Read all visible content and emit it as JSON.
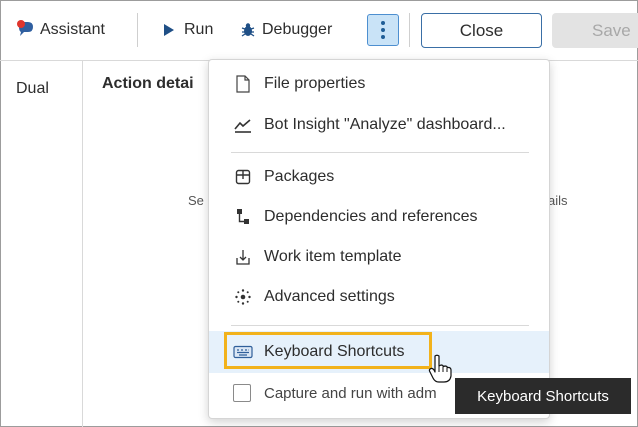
{
  "toolbar": {
    "assistant_label": "Assistant",
    "run_label": "Run",
    "debugger_label": "Debugger",
    "close_label": "Close",
    "save_label": "Save"
  },
  "left_panel": {
    "tab_label": "Dual"
  },
  "main": {
    "title": "Action detai",
    "select_fragment_left": "Se",
    "select_fragment_right": "ails"
  },
  "menu": {
    "items": [
      {
        "label": "File properties",
        "icon": "file-icon"
      },
      {
        "label": "Bot Insight \"Analyze\" dashboard...",
        "icon": "chart-line-icon"
      },
      {
        "label": "Packages",
        "icon": "package-icon"
      },
      {
        "label": "Dependencies and references",
        "icon": "dependencies-icon"
      },
      {
        "label": "Work item template",
        "icon": "work-item-icon"
      },
      {
        "label": "Advanced settings",
        "icon": "advanced-settings-icon"
      },
      {
        "label": "Keyboard Shortcuts",
        "icon": "keyboard-icon"
      },
      {
        "label": "Capture and run with adm",
        "icon": "checkbox"
      }
    ]
  },
  "tooltip": {
    "text": "Keyboard Shortcuts"
  },
  "colors": {
    "highlight": "#f2b21b",
    "kebab_bg": "#c9e3f7",
    "accent_blue": "#3a6fa6",
    "hover_row": "#e6f1fb",
    "tooltip_bg": "#2b2b2b"
  }
}
